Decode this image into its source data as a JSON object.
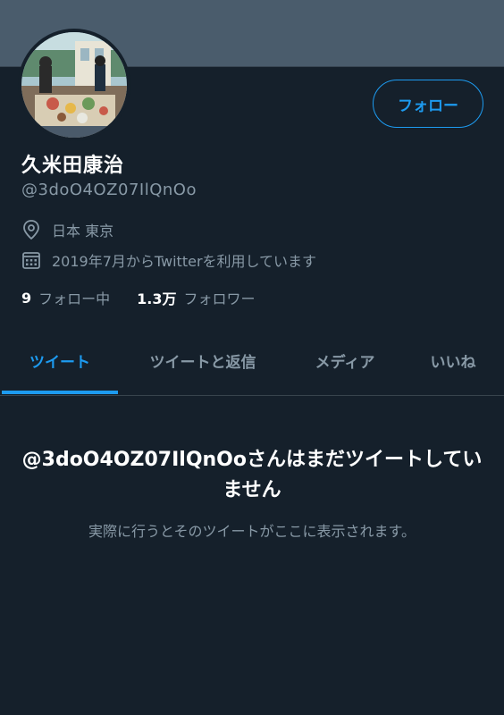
{
  "profile": {
    "display_name": "久米田康治",
    "handle": "@3doO4OZ07IlQnOo",
    "location": "日本 東京",
    "joined": "2019年7月からTwitterを利用しています",
    "follow_button": "フォロー",
    "following_count": "9",
    "following_label": "フォロー中",
    "followers_count": "1.3万",
    "followers_label": "フォロワー"
  },
  "tabs": [
    {
      "label": "ツイート",
      "active": true
    },
    {
      "label": "ツイートと返信",
      "active": false
    },
    {
      "label": "メディア",
      "active": false
    },
    {
      "label": "いいね",
      "active": false
    }
  ],
  "empty_state": {
    "title": "@3doO4OZ07IlQnOoさんはまだツイートしていません",
    "subtitle": "実際に行うとそのツイートがここに表示されます。"
  },
  "icons": {
    "location": "location-pin-icon",
    "joined": "calendar-icon"
  },
  "colors": {
    "background": "#15202b",
    "accent": "#1d9bf0",
    "secondary_text": "#8899a6",
    "banner": "#4a5c6c"
  }
}
